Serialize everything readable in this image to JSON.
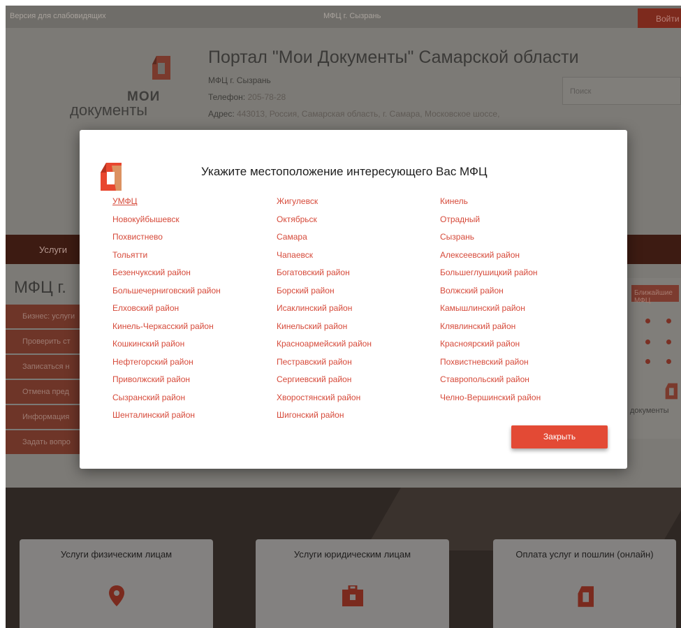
{
  "topbar": {
    "vision_label": "Версия для слабовидящих",
    "city_label": "МФЦ г. Сызрань",
    "login_label": "Войти"
  },
  "header": {
    "logo_moi": "МОИ",
    "logo_docs": "документы",
    "title": "Портал \"Мои Документы\" Самарской области",
    "mfc_name": "МФЦ г. Сызрань",
    "phone_label": "Телефон:",
    "phone_value": "205-78-28",
    "address_label": "Адрес:",
    "address_value": "443013, Россия, Самарская область, г. Самара, Московское шоссе,",
    "search_placeholder": "Поиск"
  },
  "nav": {
    "services_label": "Услуги"
  },
  "main": {
    "heading": "МФЦ г.",
    "side_menu": [
      "Бизнес: услуги",
      "Проверить ст",
      "Записаться н",
      "Отмена пред",
      "Информация",
      "Задать вопро"
    ],
    "right_panel_label": "Ближайшие МФЦ",
    "right_logo_text": "документы"
  },
  "cards": [
    {
      "title": "Услуги физическим лицам",
      "icon": "location-pin-icon"
    },
    {
      "title": "Услуги юридическим лицам",
      "icon": "briefcase-icon"
    },
    {
      "title": "Оплата услуг и пошлин (онлайн)",
      "icon": "documents-icon"
    }
  ],
  "modal": {
    "title": "Укажите местоположение интересующего Вас МФЦ",
    "columns": [
      [
        "УМФЦ",
        "Новокуйбышевск",
        "Похвистнево",
        "Тольятти",
        "Безенчукский район",
        "Большечерниговский район",
        "Елховский район",
        "Кинель-Черкасский район",
        "Кошкинский район",
        "Нефтегорский район",
        "Приволжский район",
        "Сызранский район",
        "Шенталинский район"
      ],
      [
        "Жигулевск",
        "Октябрьск",
        "Самара",
        "Чапаевск",
        "Богатовский район",
        "Борский район",
        "Исаклинский район",
        "Кинельский район",
        "Красноармейский район",
        "Пестравский район",
        "Сергиевский район",
        "Хворостянский район",
        "Шигонский район"
      ],
      [
        "Кинель",
        "Отрадный",
        "Сызрань",
        "Алексеевский район",
        "Большеглушицкий район",
        "Волжский район",
        "Камышлинский район",
        "Клявлинский район",
        "Красноярский район",
        "Похвистневский район",
        "Ставропольский район",
        "Челно-Вершинский район"
      ]
    ],
    "close_label": "Закрыть"
  },
  "colors": {
    "accent": "#e34a35",
    "link": "#d64a3a",
    "nav_dark": "#3d1b12"
  }
}
